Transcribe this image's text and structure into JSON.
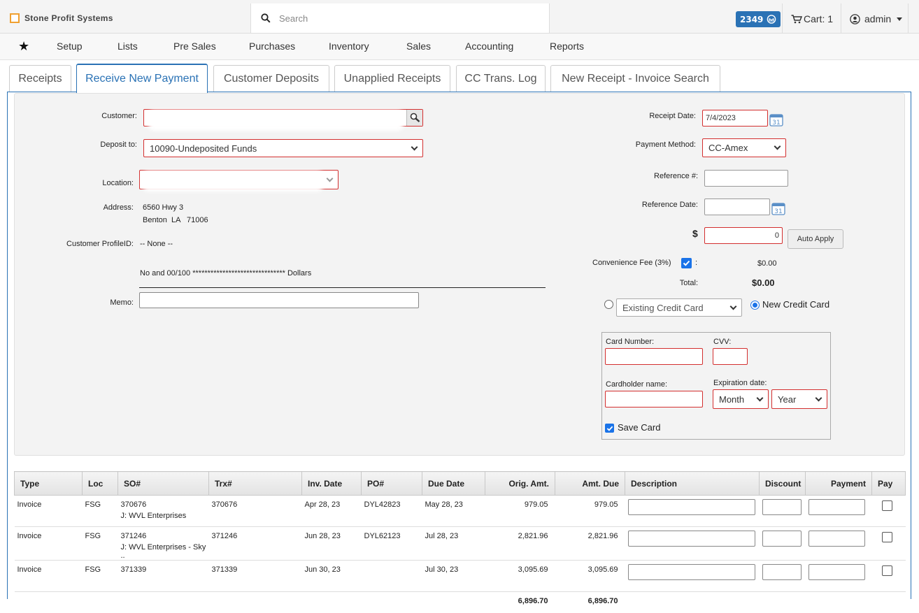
{
  "header": {
    "brand": "Stone Profit Systems",
    "search_placeholder": "Search",
    "notification_count": "2349",
    "cart_label": "Cart: 1",
    "user": "admin"
  },
  "nav": {
    "items": [
      "Setup",
      "Lists",
      "Pre Sales",
      "Purchases",
      "Inventory",
      "Sales",
      "Accounting",
      "Reports"
    ]
  },
  "tabs": [
    "Receipts",
    "Receive New Payment",
    "Customer Deposits",
    "Unapplied Receipts",
    "CC Trans. Log",
    "New Receipt - Invoice Search"
  ],
  "form": {
    "customer_label": "Customer:",
    "deposit_label": "Deposit to:",
    "deposit_value": "10090-Undeposited Funds",
    "location_label": "Location:",
    "address_label": "Address:",
    "address_line1": "6560 Hwy 3",
    "address_line2": "Benton  LA   71006",
    "profile_label": "Customer ProfileID:",
    "profile_value": "-- None --",
    "amount_words": "No and 00/100 ******************************* Dollars",
    "memo_label": "Memo:",
    "receipt_date_label": "Receipt Date:",
    "receipt_date_value": "7/4/2023",
    "payment_method_label": "Payment Method:",
    "payment_method_value": "CC-Amex",
    "reference_label": "Reference #:",
    "reference_date_label": "Reference Date:",
    "dollar_sign": "$",
    "amount_value": "0",
    "auto_apply_label": "Auto Apply",
    "conv_fee_label": "Convenience Fee (3%)",
    "conv_fee_colon": ":",
    "conv_fee_value": "$0.00",
    "total_label": "Total:",
    "total_value": "$0.00",
    "existing_cc_label": "Existing Credit Card",
    "new_cc_label": "New Credit Card",
    "card_number_label": "Card Number:",
    "cvv_label": "CVV:",
    "cardholder_label": "Cardholder name:",
    "expiration_label": "Expiration date:",
    "month_label": "Month",
    "year_label": "Year",
    "save_card_label": "Save Card"
  },
  "table": {
    "headers": [
      "Type",
      "Loc",
      "SO#",
      "Trx#",
      "Inv. Date",
      "PO#",
      "Due Date",
      "Orig. Amt.",
      "Amt. Due",
      "Description",
      "Discount",
      "Payment",
      "Pay"
    ],
    "rows": [
      {
        "type": "Invoice",
        "loc": "FSG",
        "so": "370676",
        "so_sub": "J: WVL Enterprises",
        "trx": "370676",
        "inv_date": "Apr 28, 23",
        "po": "DYL42823",
        "due_date": "May 28, 23",
        "orig": "979.05",
        "due": "979.05"
      },
      {
        "type": "Invoice",
        "loc": "FSG",
        "so": "371246",
        "so_sub": "J: WVL Enterprises - Sky ..",
        "trx": "371246",
        "inv_date": "Jun 28, 23",
        "po": "DYL62123",
        "due_date": "Jul 28, 23",
        "orig": "2,821.96",
        "due": "2,821.96"
      },
      {
        "type": "Invoice",
        "loc": "FSG",
        "so": "371339",
        "so_sub": "",
        "trx": "371339",
        "inv_date": "Jun 30, 23",
        "po": "",
        "due_date": "Jul 30, 23",
        "orig": "3,095.69",
        "due": "3,095.69"
      }
    ],
    "total_orig": "6,896.70",
    "total_due": "6,896.70"
  },
  "colors": {
    "accent": "#2a72b5",
    "required_border": "#d32f2f",
    "brand_orange": "#f0a030",
    "checkbox": "#1a73e8"
  }
}
